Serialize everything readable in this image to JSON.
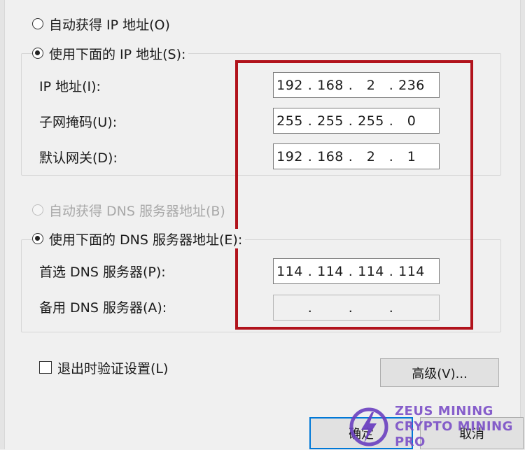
{
  "ip_section": {
    "auto_radio_label": "自动获得 IP 地址(O)",
    "manual_radio_label": "使用下面的 IP 地址(S):",
    "fields": [
      {
        "label": "IP 地址(I):",
        "segments": [
          "192",
          "168",
          "2",
          "236"
        ]
      },
      {
        "label": "子网掩码(U):",
        "segments": [
          "255",
          "255",
          "255",
          "0"
        ]
      },
      {
        "label": "默认网关(D):",
        "segments": [
          "192",
          "168",
          "2",
          "1"
        ]
      }
    ]
  },
  "dns_section": {
    "auto_radio_label": "自动获得 DNS 服务器地址(B)",
    "manual_radio_label": "使用下面的 DNS 服务器地址(E):",
    "fields": [
      {
        "label": "首选 DNS 服务器(P):",
        "segments": [
          "114",
          "114",
          "114",
          "114"
        ]
      },
      {
        "label": "备用 DNS 服务器(A):",
        "segments": [
          "",
          "",
          "",
          ""
        ]
      }
    ]
  },
  "validate_checkbox_label": "退出时验证设置(L)",
  "buttons": {
    "advanced": "高级(V)...",
    "ok": "确定",
    "cancel": "取消"
  },
  "watermark": {
    "line1": "ZEUS MINING",
    "line2": "CRYPTO MINING PRO"
  },
  "colors": {
    "highlight_box": "#b1131c",
    "focus_border": "#0078d7"
  }
}
